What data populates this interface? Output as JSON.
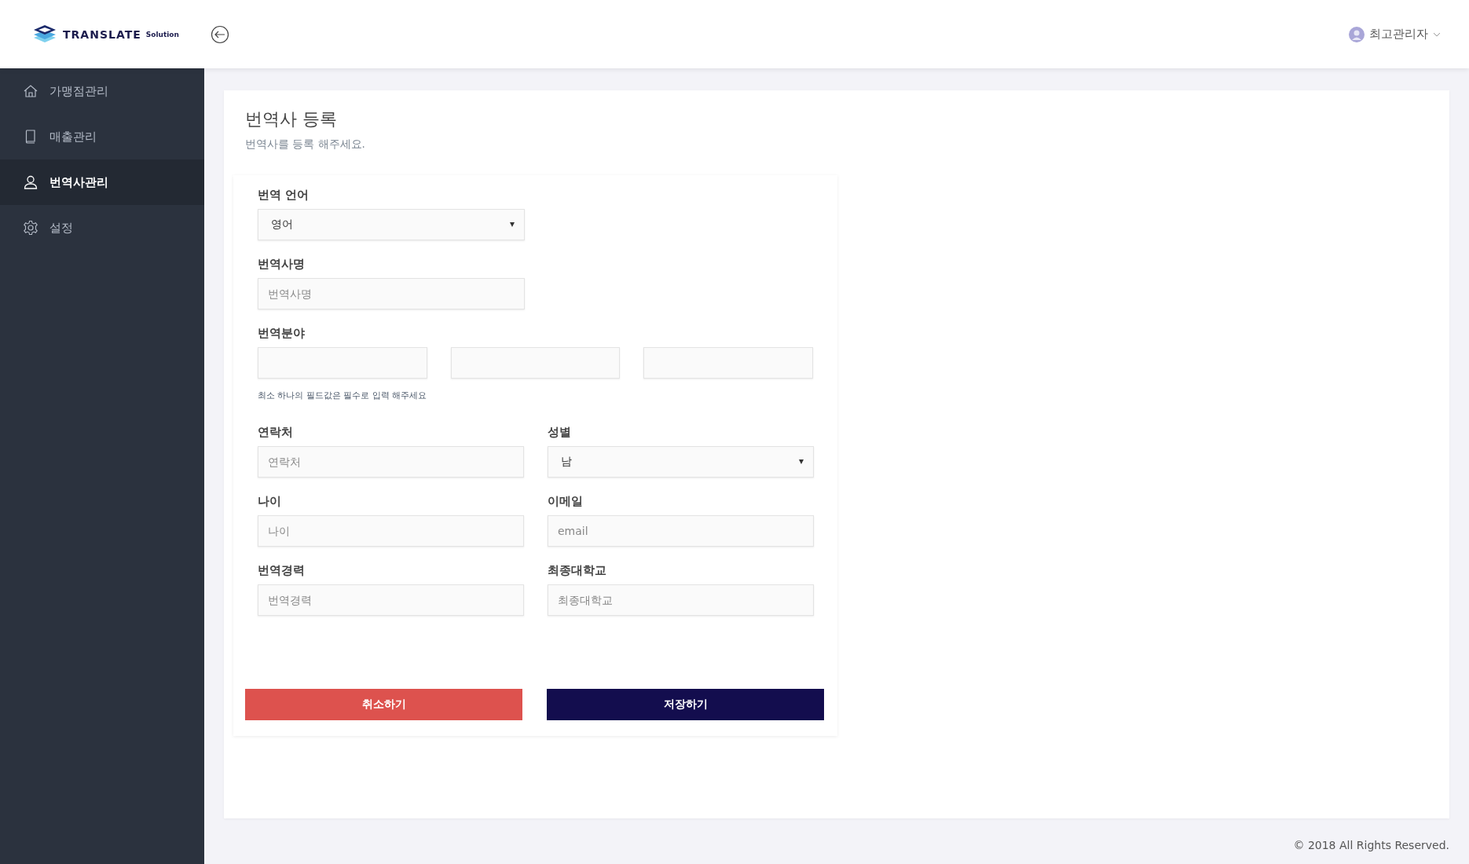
{
  "header": {
    "logo": {
      "brand": "TRANSLATE",
      "suffix": "Solution"
    },
    "user": {
      "name": "최고관리자"
    }
  },
  "sidebar": {
    "items": [
      {
        "label": "가맹점관리",
        "kind": "home",
        "selected": false
      },
      {
        "label": "매출관리",
        "kind": "book",
        "selected": false
      },
      {
        "label": "번역사관리",
        "kind": "user",
        "selected": true
      },
      {
        "label": "설정",
        "kind": "gear",
        "selected": false
      }
    ]
  },
  "page": {
    "title": "번역사 등록",
    "subtitle": "번역사를 등록 해주세요."
  },
  "form": {
    "top": [
      {
        "kind": "select",
        "label": "번역 언어",
        "value": "영어"
      },
      {
        "kind": "input",
        "label": "번역사명",
        "placeholder": "번역사명"
      }
    ],
    "fields": {
      "label": "번역분야",
      "inputs": [
        {
          "kind": "input"
        },
        {
          "kind": "input"
        },
        {
          "kind": "input"
        }
      ],
      "hint": "최소 하나의 필드값은 필수로 입력 해주세요"
    },
    "grid": [
      {
        "kind": "input",
        "label": "연락처",
        "placeholder": "연락처"
      },
      {
        "kind": "select",
        "label": "성별",
        "value": "남"
      },
      {
        "kind": "input",
        "label": "나이",
        "placeholder": "나이"
      },
      {
        "kind": "input",
        "label": "이메일",
        "placeholder": "email"
      },
      {
        "kind": "input",
        "label": "번역경력",
        "placeholder": "번역경력"
      },
      {
        "kind": "input",
        "label": "최종대학교",
        "placeholder": "최종대학교"
      }
    ],
    "buttons": [
      {
        "kind": "cancel",
        "label": "취소하기"
      },
      {
        "kind": "save",
        "label": "저장하기"
      }
    ]
  },
  "footer": "© 2018 All Rights Reserved."
}
